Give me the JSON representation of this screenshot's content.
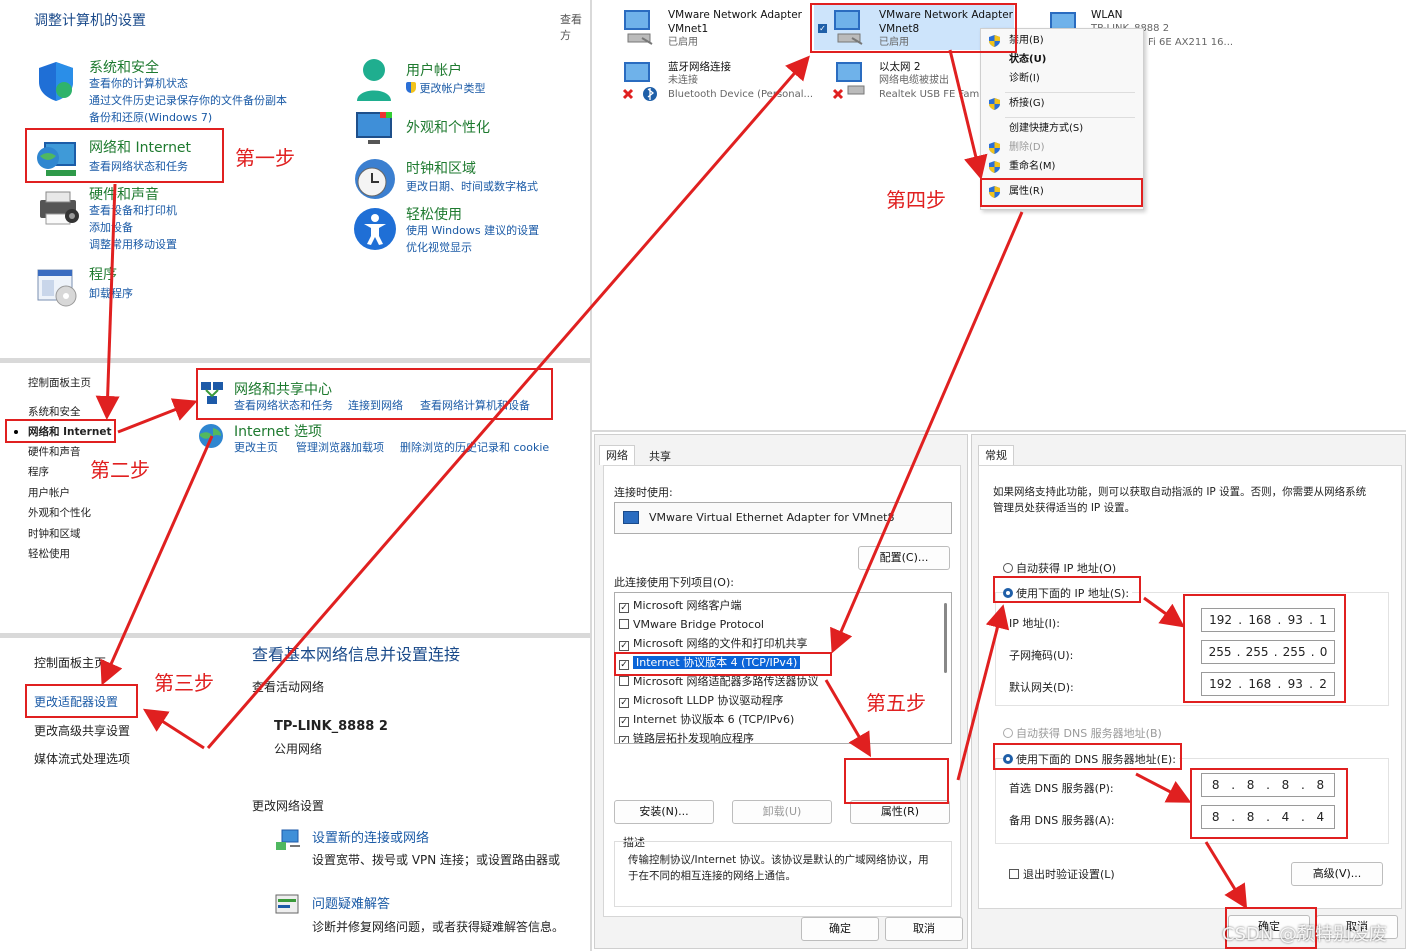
{
  "control_panel": {
    "title": "调整计算机的设置",
    "view_by": "查看方",
    "categories": [
      {
        "title": "系统和安全",
        "links": [
          "查看你的计算机状态",
          "通过文件历史记录保存你的文件备份副本",
          "备份和还原(Windows 7)"
        ]
      },
      {
        "title": "网络和 Internet",
        "links": [
          "查看网络状态和任务"
        ]
      },
      {
        "title": "硬件和声音",
        "links": [
          "查看设备和打印机",
          "添加设备",
          "调整常用移动设置"
        ]
      },
      {
        "title": "程序",
        "links": [
          "卸载程序"
        ]
      },
      {
        "title": "用户帐户",
        "links": [
          "更改帐户类型"
        ]
      },
      {
        "title": "外观和个性化",
        "links": []
      },
      {
        "title": "时钟和区域",
        "links": [
          "更改日期、时间或数字格式"
        ]
      },
      {
        "title": "轻松使用",
        "links": [
          "使用 Windows 建议的设置",
          "优化视觉显示"
        ]
      }
    ]
  },
  "network_internet": {
    "sidebar": [
      "控制面板主页",
      "系统和安全",
      "网络和 Internet",
      "硬件和声音",
      "程序",
      "用户帐户",
      "外观和个性化",
      "时钟和区域",
      "轻松使用"
    ],
    "sharing_center": {
      "title": "网络和共享中心",
      "links": [
        "查看网络状态和任务",
        "连接到网络",
        "查看网络计算机和设备"
      ]
    },
    "internet_options": {
      "title": "Internet 选项",
      "links": [
        "更改主页",
        "管理浏览器加载项",
        "删除浏览的历史记录和 cookie"
      ]
    }
  },
  "sharing_center_page": {
    "sidebar": [
      "控制面板主页",
      "更改适配器设置",
      "更改高级共享设置",
      "媒体流式处理选项"
    ],
    "heading": "查看基本网络信息并设置连接",
    "active_networks_label": "查看活动网络",
    "network_name": "TP-LINK_8888 2",
    "network_type": "公用网络",
    "change_settings_label": "更改网络设置",
    "tasks": [
      {
        "title": "设置新的连接或网络",
        "desc": "设置宽带、拨号或 VPN 连接；或设置路由器或"
      },
      {
        "title": "问题疑难解答",
        "desc": "诊断并修复网络问题，或者获得疑难解答信息。"
      }
    ]
  },
  "adapters": [
    {
      "name": "VMware Network Adapter",
      "line2": "VMnet1",
      "line3": "已启用"
    },
    {
      "name": "VMware Network Adapter",
      "line2": "VMnet8",
      "line3": "已启用"
    },
    {
      "name": "WLAN",
      "line2": "TP-LINK_8888 2",
      "line3": "Fi 6E AX211 16..."
    },
    {
      "name": "蓝牙网络连接",
      "line2": "未连接",
      "line3": "Bluetooth Device (Personal..."
    },
    {
      "name": "以太网 2",
      "line2": "网络电缆被拔出",
      "line3": "Realtek USB FE Famil"
    }
  ],
  "context_menu": [
    "禁用(B)",
    "状态(U)",
    "诊断(I)",
    "桥接(G)",
    "创建快捷方式(S)",
    "删除(D)",
    "重命名(M)",
    "属性(R)"
  ],
  "properties_dialog": {
    "tabs": [
      "网络",
      "共享"
    ],
    "connect_using_label": "连接时使用:",
    "adapter": "VMware Virtual Ethernet Adapter for VMnet8",
    "configure_button": "配置(C)...",
    "items_label": "此连接使用下列项目(O):",
    "items": [
      {
        "label": "Microsoft 网络客户端",
        "checked": true
      },
      {
        "label": "VMware Bridge Protocol",
        "checked": false
      },
      {
        "label": "Microsoft 网络的文件和打印机共享",
        "checked": true
      },
      {
        "label": "Internet 协议版本 4 (TCP/IPv4)",
        "checked": true
      },
      {
        "label": "Microsoft 网络适配器多路传送器协议",
        "checked": false
      },
      {
        "label": "Microsoft LLDP 协议驱动程序",
        "checked": true
      },
      {
        "label": "Internet 协议版本 6 (TCP/IPv6)",
        "checked": true
      },
      {
        "label": "链路层拓扑发现响应程序",
        "checked": true
      }
    ],
    "install_button": "安装(N)...",
    "uninstall_button": "卸载(U)",
    "properties_button": "属性(R)",
    "description_label": "描述",
    "description": "传输控制协议/Internet 协议。该协议是默认的广域网络协议，用于在不同的相互连接的网络上通信。",
    "ok_button": "确定",
    "cancel_button": "取消"
  },
  "ipv4_dialog": {
    "tab": "常规",
    "intro": "如果网络支持此功能，则可以获取自动指派的 IP 设置。否则，你需要从网络系统管理员处获得适当的 IP 设置。",
    "auto_ip": "自动获得 IP 地址(O)",
    "manual_ip": "使用下面的 IP 地址(S):",
    "ip_label": "IP 地址(I):",
    "mask_label": "子网掩码(U):",
    "gateway_label": "默认网关(D):",
    "ip": [
      "192",
      "168",
      "93",
      "1"
    ],
    "mask": [
      "255",
      "255",
      "255",
      "0"
    ],
    "gateway": [
      "192",
      "168",
      "93",
      "2"
    ],
    "auto_dns": "自动获得 DNS 服务器地址(B)",
    "manual_dns": "使用下面的 DNS 服务器地址(E):",
    "preferred_dns_label": "首选 DNS 服务器(P):",
    "alternate_dns_label": "备用 DNS 服务器(A):",
    "preferred_dns": [
      "8",
      "8",
      "8",
      "8"
    ],
    "alternate_dns": [
      "8",
      "8",
      "4",
      "4"
    ],
    "validate_label": "退出时验证设置(L)",
    "advanced_button": "高级(V)...",
    "ok_button": "确定",
    "cancel_button": "取消"
  },
  "steps": [
    "第一步",
    "第二步",
    "第三步",
    "第四步",
    "第五步"
  ],
  "watermark": "CSDN @颓特别没废",
  "colors": {
    "annotation_red": "#e02020",
    "link_blue": "#1a5aa6",
    "category_green": "#1e7a2f",
    "selection_blue": "#0a64d8"
  }
}
